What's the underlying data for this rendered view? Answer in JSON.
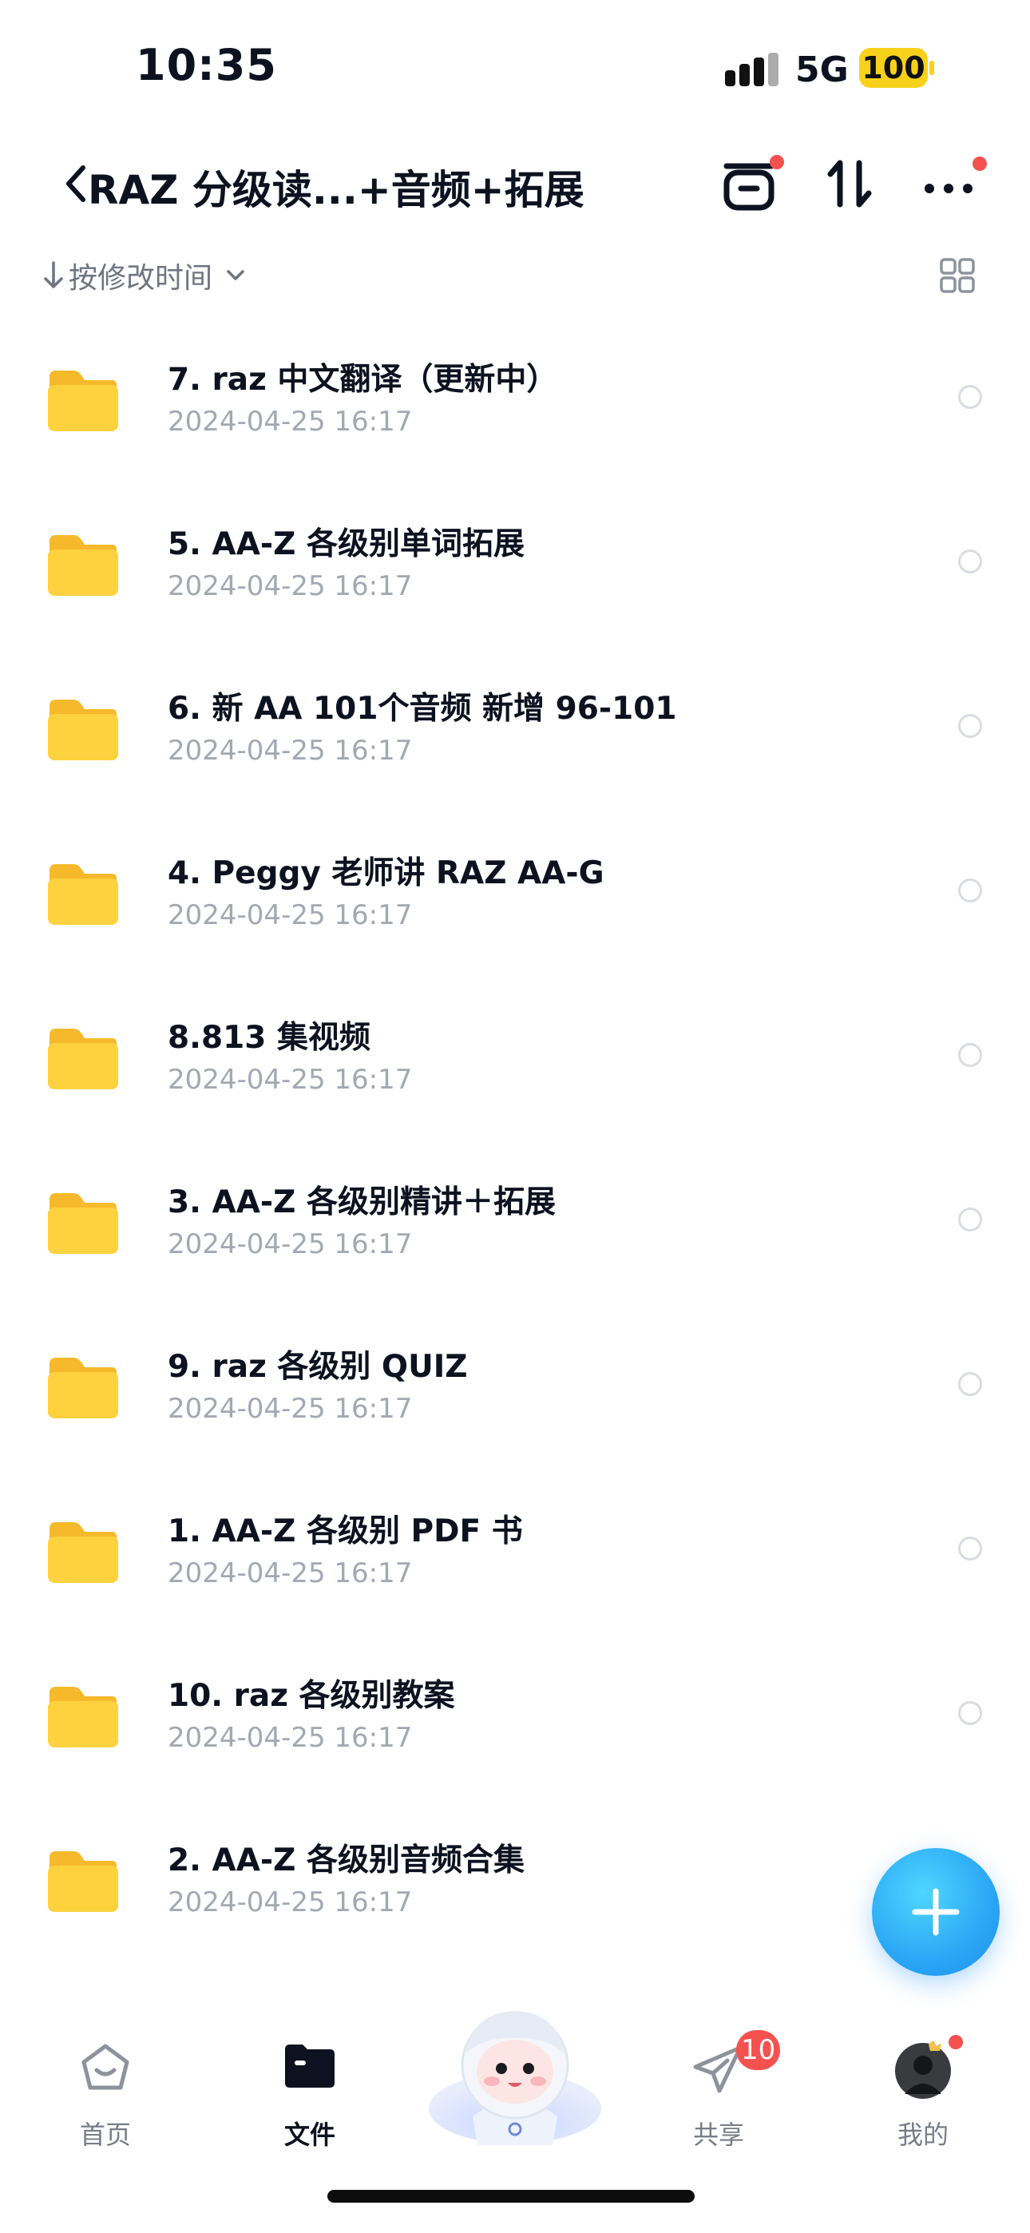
{
  "status_bar": {
    "time": "10:35",
    "network": "5G",
    "battery": "100"
  },
  "header": {
    "title": "RAZ 分级读...+音频+拓展",
    "icons": [
      "back-chevron-icon",
      "transfer-list-icon",
      "sort-arrows-icon",
      "more-icon"
    ]
  },
  "sort": {
    "label": "按修改时间"
  },
  "files": [
    {
      "name": "7. raz 中文翻译（更新中）",
      "date": "2024-04-25 16:17"
    },
    {
      "name": "5. AA-Z 各级别单词拓展",
      "date": "2024-04-25 16:17"
    },
    {
      "name": "6. 新 AA 101个音频 新增 96-101",
      "date": "2024-04-25 16:17"
    },
    {
      "name": "4. Peggy 老师讲 RAZ AA-G",
      "date": "2024-04-25 16:17"
    },
    {
      "name": "8.813 集视频",
      "date": "2024-04-25 16:17"
    },
    {
      "name": "3. AA-Z 各级别精讲＋拓展",
      "date": "2024-04-25 16:17"
    },
    {
      "name": "9. raz 各级别 QUIZ",
      "date": "2024-04-25 16:17"
    },
    {
      "name": "1. AA-Z 各级别 PDF 书",
      "date": "2024-04-25 16:17"
    },
    {
      "name": "10. raz 各级别教案",
      "date": "2024-04-25 16:17"
    },
    {
      "name": "2. AA-Z 各级别音频合集",
      "date": "2024-04-25 16:17"
    }
  ],
  "tabs": [
    {
      "label": "首页"
    },
    {
      "label": "文件"
    },
    {
      "label": "共享",
      "badge": "10"
    },
    {
      "label": "我的"
    }
  ],
  "colors": {
    "accent": "#2aa7f5",
    "folder": "#fdd23e",
    "badge": "#f5524f",
    "battery": "#f8d21a"
  }
}
